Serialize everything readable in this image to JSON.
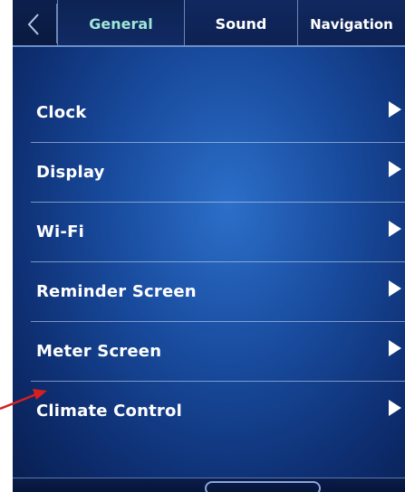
{
  "tabs": {
    "back_label": "<",
    "items": [
      {
        "label": "General",
        "active": true
      },
      {
        "label": "Sound",
        "active": false
      },
      {
        "label": "Navigation",
        "active": false
      }
    ]
  },
  "menu": {
    "items": [
      {
        "label": "Clock",
        "icon": "chevron-right-icon"
      },
      {
        "label": "Display",
        "icon": "chevron-right-icon"
      },
      {
        "label": "Wi-Fi",
        "icon": "chevron-right-icon"
      },
      {
        "label": "Reminder Screen",
        "icon": "chevron-right-icon"
      },
      {
        "label": "Meter Screen",
        "icon": "chevron-right-icon"
      },
      {
        "label": "Climate Control",
        "icon": "chevron-right-icon"
      }
    ]
  },
  "colors": {
    "active_tab_text": "#9fe6d8",
    "annotation_arrow": "#d42020",
    "screen_blue": "#184a9c"
  }
}
